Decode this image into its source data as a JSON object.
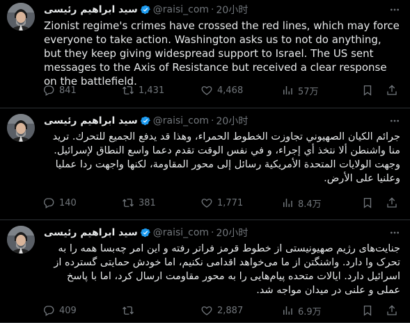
{
  "tweets": [
    {
      "author": {
        "name": "سيد ابراهيم رئيسى",
        "handle": "@raisi_com",
        "time": "20小时"
      },
      "text": "Zionist regime's crimes have crossed the red lines, which may force everyone to take action. Washington asks us to not do anything, but they keep giving widespread support to Israel. The US sent messages to the Axis of Resistance but received a clear response on the battlefield.",
      "direction": "ltr",
      "stats": {
        "replies": "841",
        "retweets": "1,431",
        "likes": "4,468",
        "views": "57万"
      }
    },
    {
      "author": {
        "name": "سيد ابراهيم رئيسى",
        "handle": "@raisi_com",
        "time": "20小时"
      },
      "text": "جرائم الكيان الصهيوني تجاوزت الخطوط الحمراء، وهذا قد يدفع الجميع للتحرك. تريد منا واشنطن ألا نتخذ أي إجراء، و في نفس الوقت تقدم دعما واسع النطاق لإسرائيل. وجهت الولايات المتحدة الأمريكية رسائل إلى محور المقاومة، لكنها واجهت ردا عمليا وعلنيا على الأرض.",
      "direction": "rtl",
      "stats": {
        "replies": "140",
        "retweets": "381",
        "likes": "1,771",
        "views": "8.4万"
      }
    },
    {
      "author": {
        "name": "سيد ابراهيم رئيسى",
        "handle": "@raisi_com",
        "time": "20小时"
      },
      "text": "جنایت‌های رژیم صهیونیستی از خطوط قرمز فراتر رفته و این امر چه‌بسا همه را به تحرک وا دارد. واشنگتن از ما می‌خواهد اقدامی نکنیم، اما خودش حمایتی گسترده از اسرائیل دارد. ایالات متحده پیام‌هایی را به محور مقاومت ارسال کرد، اما با پاسخ عملی و علنی در میدان مواجه شد.",
      "direction": "rtl",
      "stats": {
        "replies": "409",
        "retweets": "",
        "likes": "2,887",
        "views": "6.9万"
      }
    }
  ],
  "icons": {
    "verified": "verified-badge-icon",
    "more": "more-icon",
    "reply": "reply-icon",
    "retweet": "retweet-icon",
    "like": "like-icon",
    "views": "views-icon",
    "bookmark": "bookmark-icon",
    "share": "share-icon"
  },
  "colors": {
    "background": "#000000",
    "text": "#e7e9ea",
    "muted": "#71767b",
    "divider": "#2f3336",
    "verified": "#1d9bf0"
  }
}
